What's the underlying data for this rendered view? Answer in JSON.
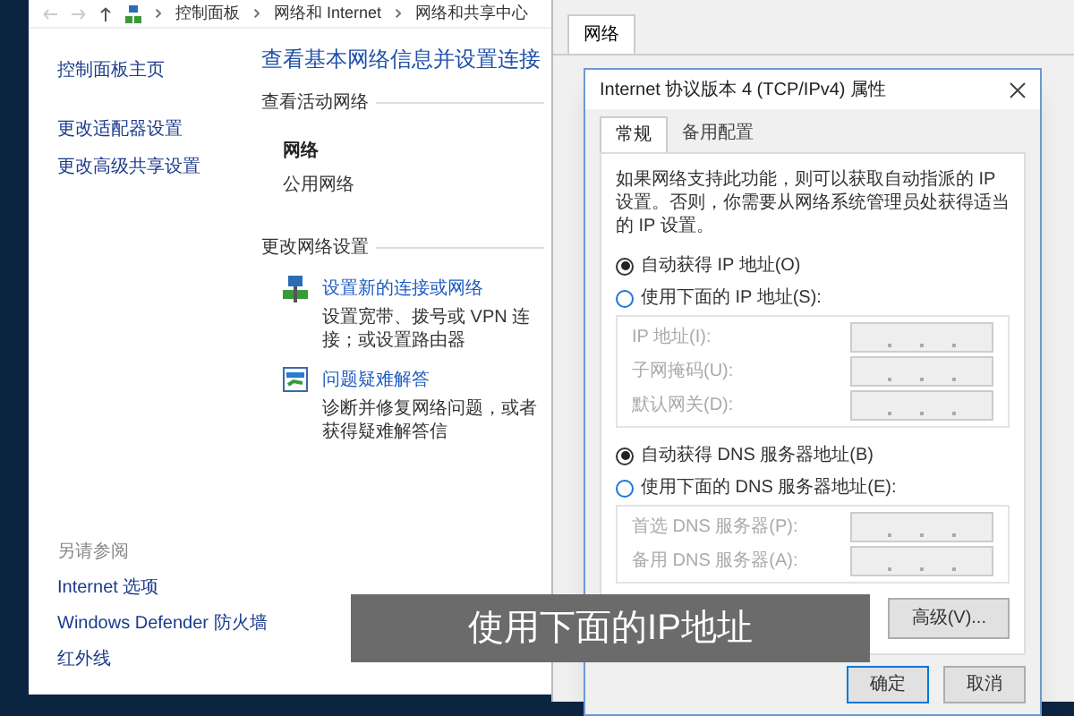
{
  "control_panel": {
    "breadcrumb": [
      "控制面板",
      "网络和 Internet",
      "网络和共享中心"
    ],
    "sidebar": {
      "links": [
        "控制面板主页",
        "更改适配器设置",
        "更改高级共享设置"
      ],
      "see_also": {
        "heading": "另请参阅",
        "links": [
          "Internet 选项",
          "Windows Defender 防火墙",
          "红外线"
        ]
      }
    },
    "main": {
      "title": "查看基本网络信息并设置连接",
      "active_networks": {
        "heading": "查看活动网络",
        "name": "网络",
        "type": "公用网络"
      },
      "change_settings": {
        "heading": "更改网络设置",
        "tasks": [
          {
            "kind": "new-connection",
            "link": "设置新的连接或网络",
            "description": "设置宽带、拨号或 VPN 连接；或设置路由器"
          },
          {
            "kind": "troubleshoot",
            "link": "问题疑难解答",
            "description": "诊断并修复网络问题，或者获得疑难解答信"
          }
        ]
      }
    }
  },
  "network_properties": {
    "tabs": [
      {
        "label": "网络",
        "selected": true
      }
    ]
  },
  "ipv4_dialog": {
    "title": "Internet 协议版本 4 (TCP/IPv4) 属性",
    "tabs": [
      {
        "label": "常规",
        "selected": true
      },
      {
        "label": "备用配置",
        "selected": false
      }
    ],
    "description": "如果网络支持此功能，则可以获取自动指派的 IP 设置。否则，你需要从网络系统管理员处获得适当的 IP 设置。",
    "ip_options": [
      {
        "label": "自动获得 IP 地址(O)",
        "selected": true
      },
      {
        "label": "使用下面的 IP 地址(S):",
        "selected": false
      }
    ],
    "ip_fields": [
      "IP 地址(I):",
      "子网掩码(U):",
      "默认网关(D):"
    ],
    "dns_options": [
      {
        "label": "自动获得 DNS 服务器地址(B)",
        "selected": true
      },
      {
        "label": "使用下面的 DNS 服务器地址(E):",
        "selected": false
      }
    ],
    "dns_fields": [
      "首选 DNS 服务器(P):",
      "备用 DNS 服务器(A):"
    ],
    "buttons": {
      "advanced": "高级(V)...",
      "ok": "确定",
      "cancel": "取消"
    }
  },
  "subtitle": "使用下面的IP地址"
}
